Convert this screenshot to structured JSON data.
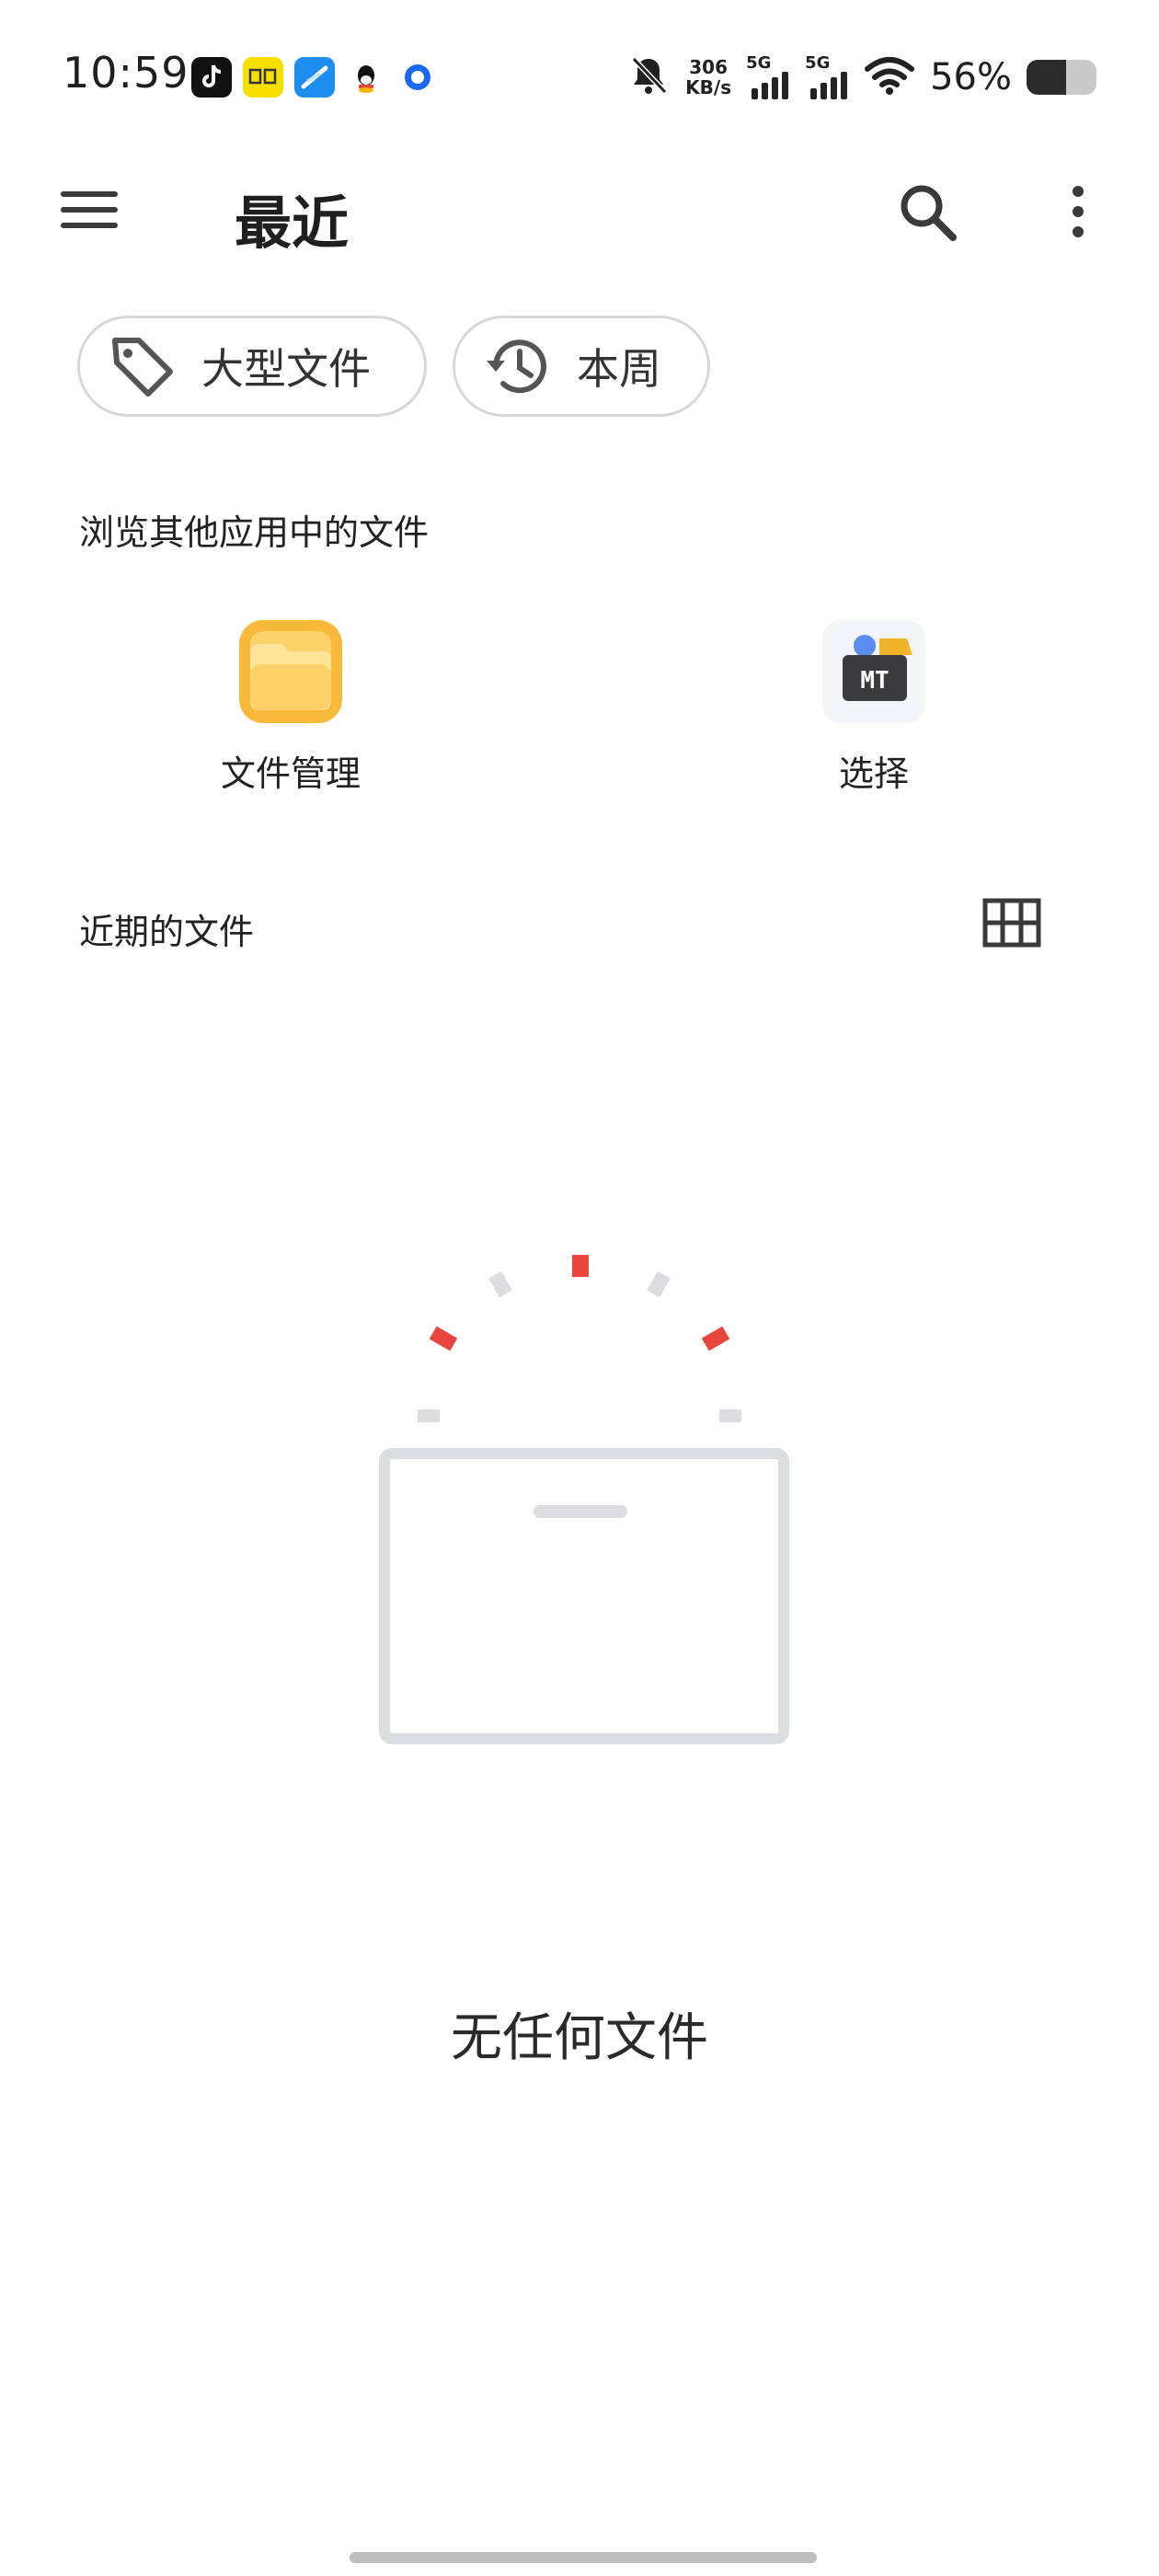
{
  "status_bar": {
    "time": "10:59",
    "notification_icons": [
      "tiktok-icon",
      "guoyuan-app-icon",
      "feather-app-icon",
      "qq-icon",
      "circle-app-icon"
    ],
    "net_speed_value": "306",
    "net_speed_unit": "KB/s",
    "sim1_label": "5G",
    "sim2_label": "5G",
    "battery_text": "56%",
    "battery_level": 0.56,
    "muted": true
  },
  "app_bar": {
    "title": "最近",
    "menu_icon": "hamburger-menu-icon",
    "search_icon": "search-icon",
    "more_icon": "more-vertical-icon"
  },
  "filters": [
    {
      "label": "大型文件",
      "icon": "tag-icon"
    },
    {
      "label": "本周",
      "icon": "history-icon"
    }
  ],
  "browse_section": {
    "title": "浏览其他应用中的文件",
    "apps": [
      {
        "label": "文件管理",
        "icon": "folder-app-icon"
      },
      {
        "label": "选择",
        "icon": "mt-manager-icon",
        "icon_text": "MT"
      }
    ]
  },
  "recent_section": {
    "title": "近期的文件",
    "view_toggle_icon": "grid-view-icon"
  },
  "empty_state": {
    "message": "无任何文件",
    "accent_color": "#e8453c",
    "neutral_color": "#dcdde0"
  }
}
